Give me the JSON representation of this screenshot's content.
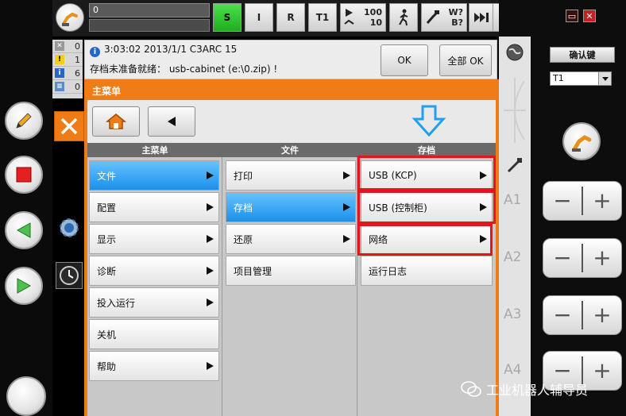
{
  "topbar": {
    "program_line": "0",
    "status_s": "S",
    "status_i": "I",
    "status_r": "R",
    "mode": "T1",
    "override_top": "100",
    "override_bottom": "10",
    "tool_top": "W?",
    "tool_bottom": "B?",
    "infinite": "∞"
  },
  "message_counts": [
    "0",
    "1",
    "6",
    "0"
  ],
  "message": {
    "time": "3:03:02 2013/1/1  C3ARC 15",
    "text": "存档未准备就绪： usb-cabinet (e:\\0.zip) !",
    "ok_label": "OK",
    "all_ok_label": "全部 OK"
  },
  "panel": {
    "title": "主菜单",
    "col_headers": [
      "主菜单",
      "文件",
      "存档"
    ],
    "main_items": [
      {
        "label": "文件",
        "arrow": true
      },
      {
        "label": "配置",
        "arrow": true
      },
      {
        "label": "显示",
        "arrow": true
      },
      {
        "label": "诊断",
        "arrow": true
      },
      {
        "label": "投入运行",
        "arrow": true
      },
      {
        "label": "关机",
        "arrow": false
      },
      {
        "label": "帮助",
        "arrow": true
      }
    ],
    "file_items": [
      {
        "label": "打印",
        "arrow": true
      },
      {
        "label": "存档",
        "arrow": true
      },
      {
        "label": "还原",
        "arrow": true
      },
      {
        "label": "项目管理",
        "arrow": false
      }
    ],
    "archive_items": [
      {
        "label": "USB (KCP)",
        "arrow": true
      },
      {
        "label": "USB (控制柜)",
        "arrow": true
      },
      {
        "label": "网络",
        "arrow": true
      },
      {
        "label": "运行日志",
        "arrow": false
      }
    ]
  },
  "right": {
    "confirm_label": "确认键",
    "mode_select": "T1",
    "axes": [
      "A1",
      "A2",
      "A3",
      "A4"
    ],
    "minus": "−",
    "plus": "+"
  },
  "watermark": "工业机器人辅导员",
  "colors": {
    "accent": "#f07c18",
    "selected": "#1990ec",
    "highlight": "#e5151f"
  }
}
